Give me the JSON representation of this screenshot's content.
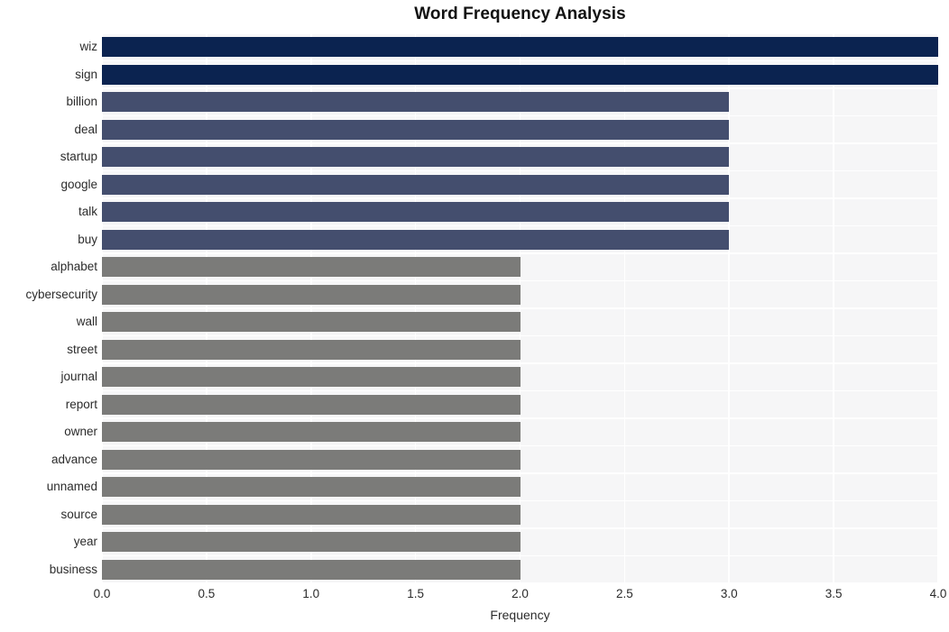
{
  "chart_data": {
    "type": "bar",
    "orientation": "horizontal",
    "title": "Word Frequency Analysis",
    "xlabel": "Frequency",
    "ylabel": "",
    "xlim": [
      0.0,
      4.0
    ],
    "xticks": [
      "0.0",
      "0.5",
      "1.0",
      "1.5",
      "2.0",
      "2.5",
      "3.0",
      "3.5",
      "4.0"
    ],
    "xtick_values": [
      0.0,
      0.5,
      1.0,
      1.5,
      2.0,
      2.5,
      3.0,
      3.5,
      4.0
    ],
    "grid": true,
    "legend": null,
    "categories": [
      "wiz",
      "sign",
      "billion",
      "deal",
      "startup",
      "google",
      "talk",
      "buy",
      "alphabet",
      "cybersecurity",
      "wall",
      "street",
      "journal",
      "report",
      "owner",
      "advance",
      "unnamed",
      "source",
      "year",
      "business"
    ],
    "values": [
      4,
      4,
      3,
      3,
      3,
      3,
      3,
      3,
      2,
      2,
      2,
      2,
      2,
      2,
      2,
      2,
      2,
      2,
      2,
      2
    ],
    "bar_colors": [
      "#0b2350",
      "#0b2350",
      "#444e6e",
      "#444e6e",
      "#444e6e",
      "#444e6e",
      "#444e6e",
      "#444e6e",
      "#7b7b79",
      "#7b7b79",
      "#7b7b79",
      "#7b7b79",
      "#7b7b79",
      "#7b7b79",
      "#7b7b79",
      "#7b7b79",
      "#7b7b79",
      "#7b7b79",
      "#7b7b79",
      "#7b7b79"
    ],
    "colors": {
      "high": "#0b2350",
      "medium": "#444e6e",
      "low": "#7b7b79",
      "plot_background": "#f6f6f7",
      "figure_background": "#ffffff",
      "gridline": "#ffffff",
      "text": "#2b2b2b",
      "title_text": "#121212"
    }
  }
}
